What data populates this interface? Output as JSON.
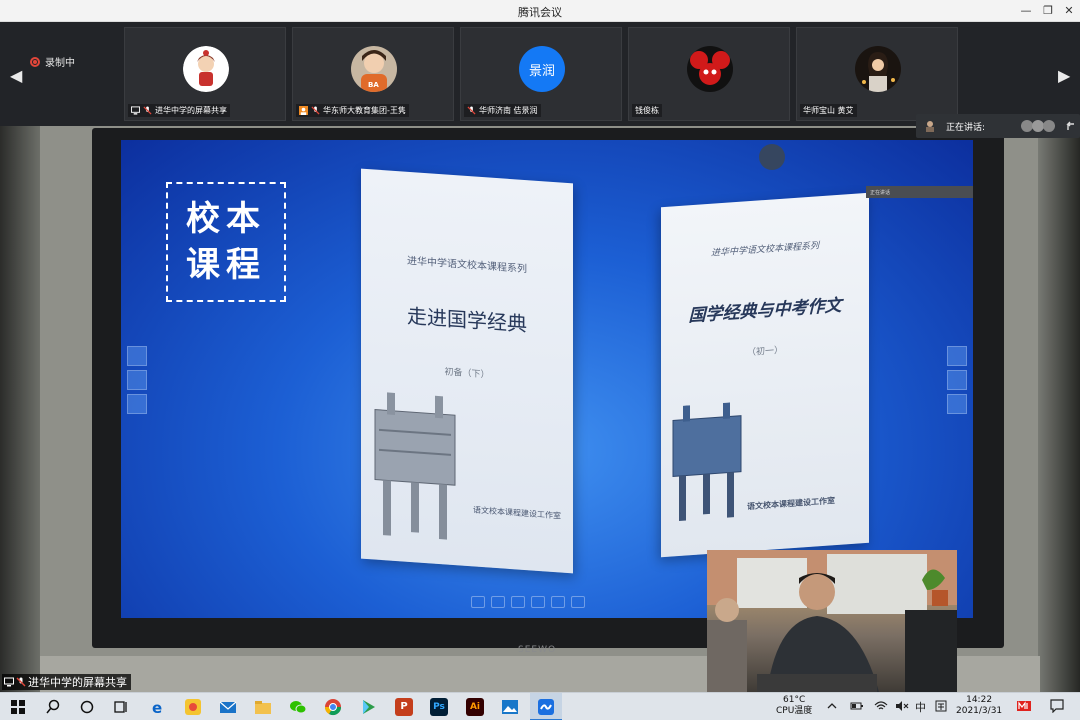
{
  "window": {
    "title": "腾讯会议",
    "minimize_glyph": "—",
    "restore_glyph": "❐",
    "close_glyph": "✕"
  },
  "recording": {
    "label": "录制中"
  },
  "nav": {
    "prev_glyph": "◀",
    "next_glyph": "▶"
  },
  "participants": [
    {
      "name": "进华中学的屏幕共享",
      "avatar": "cartoon-girl-avatar",
      "status_icon": "screen-share-icon"
    },
    {
      "name": "华东师大教育集团-王隽",
      "avatar": "photo-child-avatar",
      "status_icon": "user-orange-icon"
    },
    {
      "name": "华师济南 佶景润",
      "avatar_text": "景润",
      "avatar_color": "#1479f5"
    },
    {
      "name": "钱俊栋",
      "avatar": "mouse-ears-avatar"
    },
    {
      "name": "华师宝山 黄艾",
      "avatar": "night-photo-avatar"
    }
  ],
  "speaking": {
    "label": "正在讲话:"
  },
  "slide": {
    "stamp_text": "校本课程",
    "book1": {
      "series": "进华中学语文校本课程系列",
      "title": "走进国学经典",
      "subtitle": "初备（下）",
      "publisher": "语文校本课程建设工作室"
    },
    "book2": {
      "series": "进华中学语文校本课程系列",
      "title": "国学经典与中考作文",
      "subtitle": "（初一）",
      "publisher": "语文校本课程建设工作室"
    },
    "mini_bar_label": "正在讲话",
    "monitor_brand": "SEEWO"
  },
  "screen_share_label": "进华中学的屏幕共享",
  "taskbar": {
    "temp": "61°C",
    "temp_label": "CPU温度",
    "ime": "中",
    "time": "14:22",
    "date": "2021/3/31"
  },
  "colors": {
    "accent": "#2b78d0",
    "record": "#e2463a",
    "avatar_blue": "#1479f5"
  }
}
